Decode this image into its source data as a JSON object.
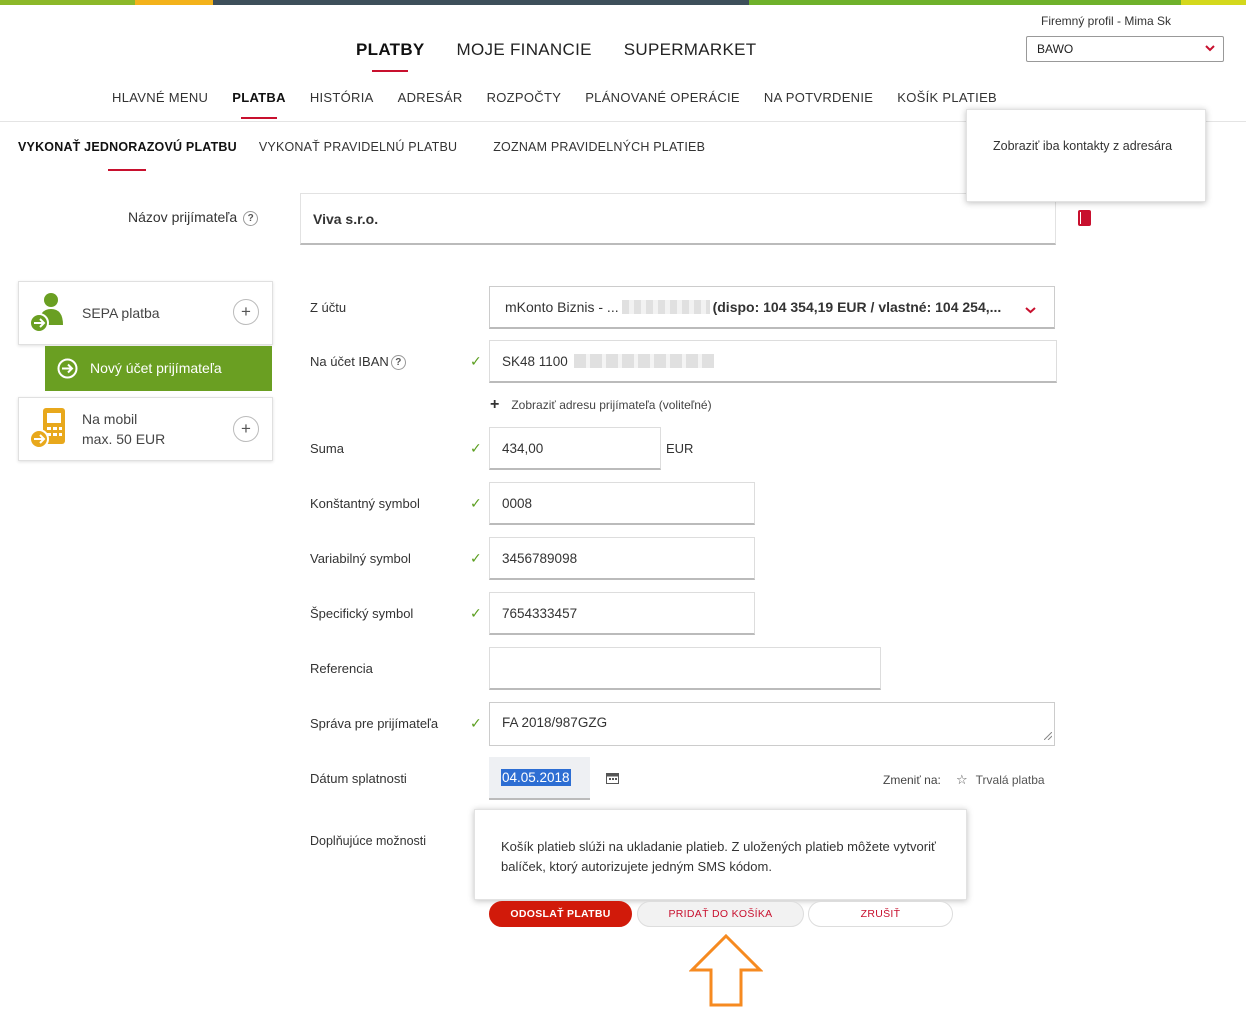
{
  "colors": {
    "topbar": [
      "#8cb829",
      "#f3b21b",
      "#3d4f5a",
      "#6fb12b",
      "#d4d81c"
    ],
    "accent": "#c8102e",
    "green": "#6a9f22",
    "check": "#5a9e1e",
    "arrow": "#f68a20"
  },
  "header": {
    "main_nav": [
      "PLATBY",
      "MOJE FINANCIE",
      "SUPERMARKET"
    ],
    "profile_label": "Firemný profil  -  Mima Sk",
    "profile_select": "BAWO",
    "sub_nav": [
      "HLAVNÉ MENU",
      "PLATBA",
      "HISTÓRIA",
      "ADRESÁR",
      "ROZPOČTY",
      "PLÁNOVANÉ OPERÁCIE",
      "NA POTVRDENIE",
      "KOŠÍK PLATIEB"
    ]
  },
  "tabs": [
    "VYKONAŤ JEDNORAZOVÚ PLATBU",
    "VYKONAŤ PRAVIDELNÚ PLATBU",
    "ZOZNAM PRAVIDELNÝCH PLATIEB"
  ],
  "tooltip_contacts": "Zobraziť iba kontakty z adresára",
  "recipient": {
    "label": "Názov prijímateľa",
    "value": "Viva s.r.o."
  },
  "sidebar": {
    "sepa": "SEPA platba",
    "new_account": "Nový účet prijímateľa",
    "mobile_line1": "Na mobil",
    "mobile_line2": "max. 50 EUR"
  },
  "form": {
    "from_account_label": "Z účtu",
    "from_account_prefix": "mKonto Biznis - ...",
    "from_account_suffix": "(dispo: 104 354,19 EUR / vlastné: 104 254,...",
    "iban_label": "Na účet IBAN",
    "iban_value": "SK48 1100",
    "show_address": "Zobraziť adresu prijímateľa (voliteľné)",
    "amount_label": "Suma",
    "amount_value": "434,00",
    "currency": "EUR",
    "const_label": "Konštantný symbol",
    "const_value": "0008",
    "var_label": "Variabilný symbol",
    "var_value": "3456789098",
    "spec_label": "Špecifický symbol",
    "spec_value": "7654333457",
    "ref_label": "Referencia",
    "ref_value": "",
    "msg_label": "Správa pre prijímateľa",
    "msg_value": "FA 2018/987GZG",
    "date_label": "Dátum splatnosti",
    "date_value": "04.05.2018",
    "change_to": "Zmeniť na:",
    "permanent": "Trvalá platba",
    "extra_label": "Doplňujúce možnosti"
  },
  "tooltip_cart": "Košík platieb slúži na ukladanie platieb. Z uložených platieb môžete vytvoriť balíček, ktorý autorizujete jedným SMS kódom.",
  "buttons": {
    "send": "ODOSLAŤ PLATBU",
    "add_cart": "PRIDAŤ DO KOŠÍKA",
    "cancel": "ZRUŠIŤ"
  }
}
